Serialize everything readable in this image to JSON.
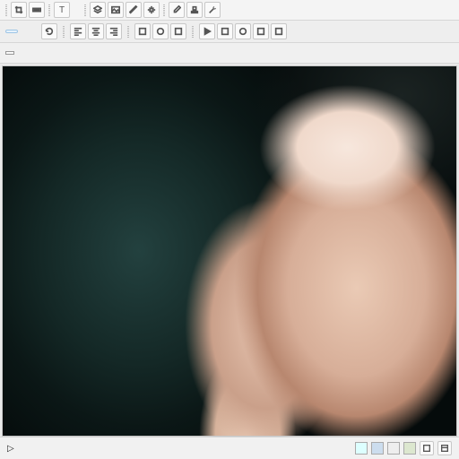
{
  "toolbar_top": {
    "groups": [
      {
        "items": [
          {
            "icon": "crop-icon"
          },
          {
            "icon": "ruler-icon"
          }
        ]
      },
      {
        "sep": true
      },
      {
        "items": [
          {
            "icon": "text-icon",
            "glyph": "T"
          },
          {
            "label": ""
          },
          {
            "label": ""
          }
        ]
      },
      {
        "sep": true
      },
      {
        "items": [
          {
            "icon": "layers-icon"
          },
          {
            "icon": "image-icon"
          },
          {
            "icon": "paint-icon"
          },
          {
            "icon": "cog-icon"
          }
        ]
      },
      {
        "sep": true
      },
      {
        "items": [
          {
            "icon": "eyedrop-icon"
          },
          {
            "icon": "stamp-icon"
          },
          {
            "icon": "wand-icon"
          }
        ]
      }
    ]
  },
  "toolbar_options": {
    "mode_chip": "",
    "labels": [
      "",
      "",
      ""
    ],
    "icon_buttons": [
      "align-left-icon",
      "align-center-icon",
      "align-right-icon",
      "square-icon",
      "circle-icon",
      "square-icon",
      "play-icon",
      "square-icon",
      "circle-icon",
      "square-icon",
      "square-icon"
    ]
  },
  "info_row": {
    "path_tag": "",
    "zoom_label": ""
  },
  "canvas": {
    "description": "Studio portrait photograph of a young woman, short dark hair, green eyes, hand under chin, teal smoky background"
  },
  "statusbar": {
    "coord_label": "",
    "cursor_glyph": "▷",
    "tray_icons": [
      "swatch-a",
      "swatch-b",
      "swatch-c",
      "swatch-d",
      "view-toggle",
      "view-toggle"
    ]
  }
}
